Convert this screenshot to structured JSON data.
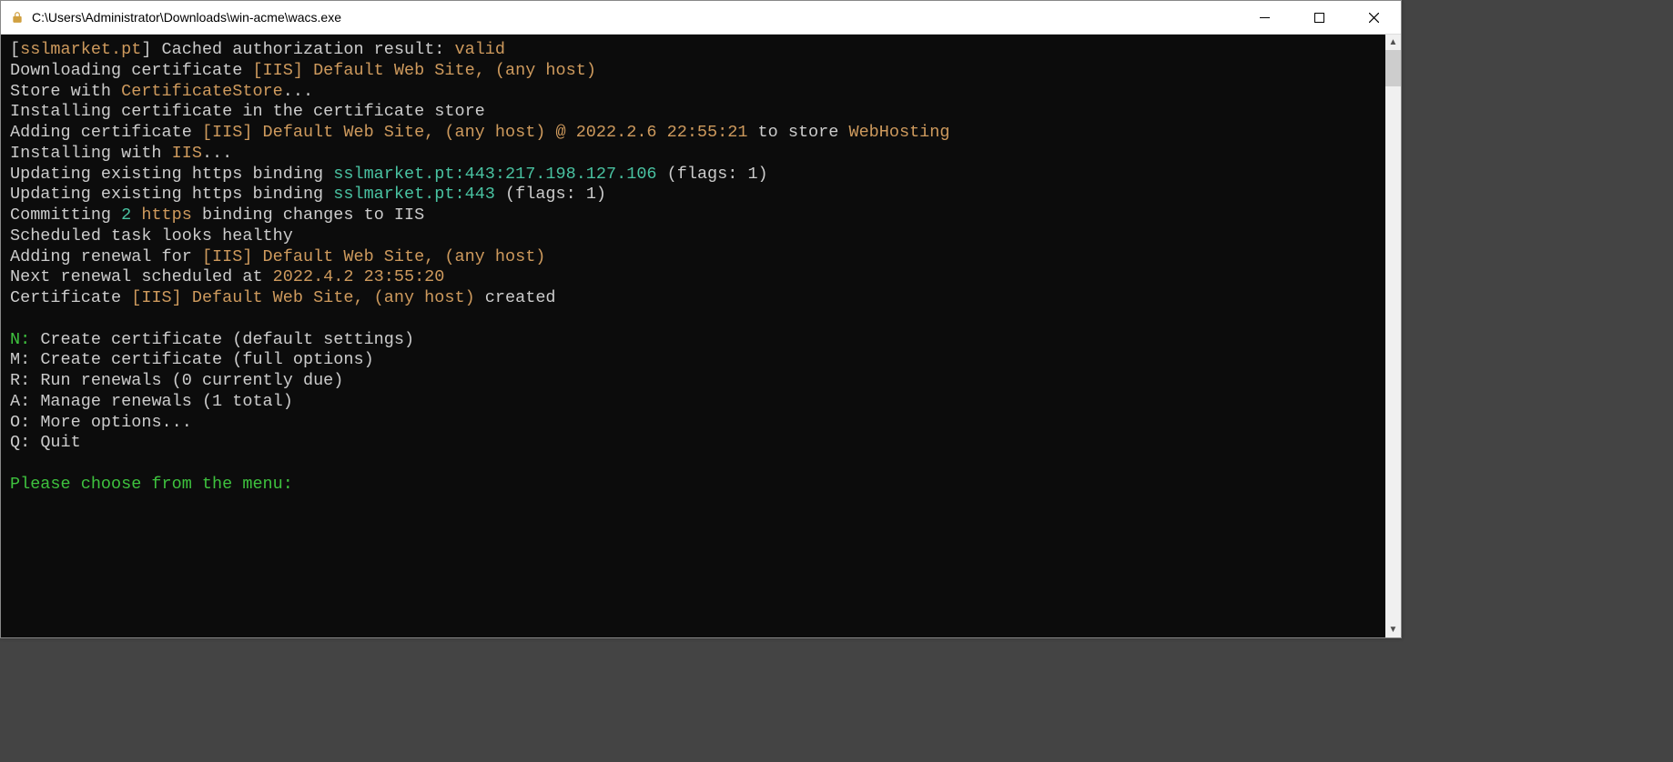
{
  "window": {
    "title": "C:\\Users\\Administrator\\Downloads\\win-acme\\wacs.exe"
  },
  "colors": {
    "orange": "#ce9a5d",
    "green": "#3ec23e",
    "teal": "#49c2a1",
    "text": "#cccccc"
  },
  "log": {
    "l1_open": "[",
    "l1_domain": "sslmarket.pt",
    "l1_close_text": "] Cached authorization result: ",
    "l1_valid": "valid",
    "l2_pre": "Downloading certificate ",
    "l2_orange": "[IIS] Default Web Site, (any host)",
    "l3_pre": "Store with ",
    "l3_orange": "CertificateStore",
    "l3_post": "...",
    "l4": "Installing certificate in the certificate store",
    "l5_pre": "Adding certificate ",
    "l5_orange": "[IIS] Default Web Site, (any host) @ 2022.2.6 22:55:21",
    "l5_mid": " to store ",
    "l5_orange2": "WebHosting",
    "l6_pre": "Installing with ",
    "l6_orange": "IIS",
    "l6_post": "...",
    "l7_pre": "Updating existing https binding ",
    "l7_teal": "sslmarket.pt:443:217.198.127.106",
    "l7_post": " (flags: 1)",
    "l8_pre": "Updating existing https binding ",
    "l8_teal": "sslmarket.pt:443",
    "l8_post": " (flags: 1)",
    "l9_pre": "Committing ",
    "l9_teal": "2",
    "l9_mid": " ",
    "l9_orange": "https",
    "l9_post": " binding changes to IIS",
    "l10": "Scheduled task looks healthy",
    "l11_pre": "Adding renewal for ",
    "l11_orange": "[IIS] Default Web Site, (any host)",
    "l12_pre": "Next renewal scheduled at ",
    "l12_orange": "2022.4.2 23:55:20",
    "l13_pre": "Certificate ",
    "l13_orange": "[IIS] Default Web Site, (any host)",
    "l13_post": " created"
  },
  "menu": {
    "items": [
      {
        "key": "N:",
        "key_green": true,
        "label": " Create certificate (default settings)"
      },
      {
        "key": "M:",
        "key_green": false,
        "label": " Create certificate (full options)"
      },
      {
        "key": "R:",
        "key_green": false,
        "label": " Run renewals (0 currently due)"
      },
      {
        "key": "A:",
        "key_green": false,
        "label": " Manage renewals (1 total)"
      },
      {
        "key": "O:",
        "key_green": false,
        "label": " More options..."
      },
      {
        "key": "Q:",
        "key_green": false,
        "label": " Quit"
      }
    ],
    "prompt": "Please choose from the menu:"
  }
}
